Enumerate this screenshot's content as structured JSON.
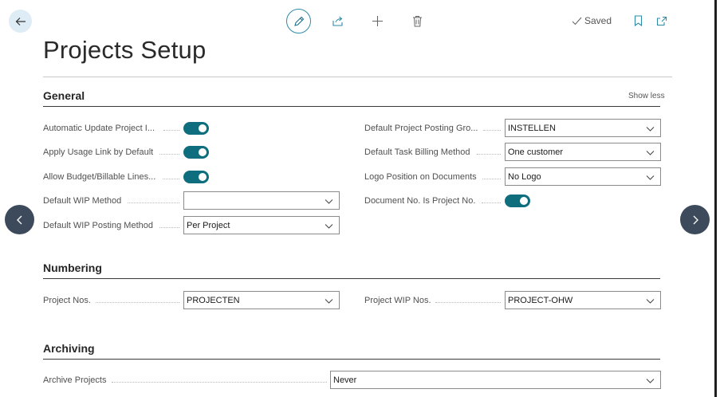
{
  "header": {
    "saved_label": "Saved",
    "title": "Projects Setup"
  },
  "general": {
    "title": "General",
    "show_less": "Show less",
    "fields": {
      "auto_update_label": "Automatic Update Project I...",
      "usage_link_label": "Apply Usage Link by Default",
      "allow_budget_label": "Allow Budget/Billable Lines...",
      "wip_method_label": "Default WIP Method",
      "wip_method_value": "",
      "wip_posting_label": "Default WIP Posting Method",
      "wip_posting_value": "Per Project",
      "posting_group_label": "Default Project Posting Gro...",
      "posting_group_value": "INSTELLEN",
      "task_billing_label": "Default Task Billing Method",
      "task_billing_value": "One customer",
      "logo_position_label": "Logo Position on Documents",
      "logo_position_value": "No Logo",
      "doc_no_label": "Document No. Is Project No."
    },
    "toggles": {
      "auto_update": true,
      "usage_link": true,
      "allow_budget": true,
      "doc_no": true
    }
  },
  "numbering": {
    "title": "Numbering",
    "project_nos_label": "Project Nos.",
    "project_nos_value": "PROJECTEN",
    "wip_nos_label": "Project WIP Nos.",
    "wip_nos_value": "PROJECT-OHW"
  },
  "archiving": {
    "title": "Archiving",
    "archive_label": "Archive Projects",
    "archive_value": "Never"
  },
  "icons": [
    "back-arrow-icon",
    "edit-icon",
    "share-icon",
    "plus-icon",
    "trash-icon",
    "check-icon",
    "bookmark-icon",
    "popout-icon",
    "chevron-left-icon",
    "chevron-right-icon",
    "chevron-down-icon"
  ],
  "colors": {
    "toggle_on": "#0f6e7e",
    "edit_ring": "#2f8aa8",
    "nav_arrow": "#3d4a5c",
    "back_bg": "#deecf5"
  }
}
